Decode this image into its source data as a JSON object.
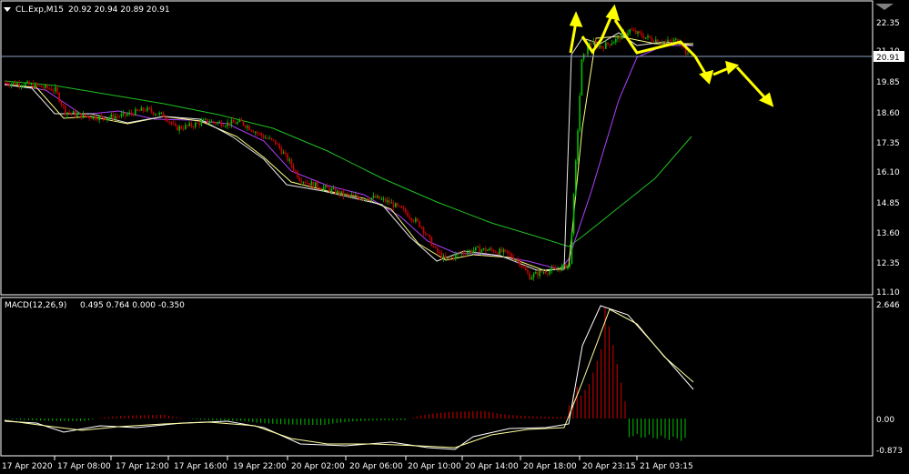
{
  "header": {
    "symbol": "CL.Exp,M15",
    "ohlc": "20.92 20.94 20.89 20.91"
  },
  "macd": {
    "label": "MACD(12,26,9)",
    "values": "0.495 0.764 0.000 -0.350"
  },
  "price_axis": {
    "ticks": [
      "22.35",
      "21.10",
      "19.85",
      "18.60",
      "17.35",
      "16.10",
      "14.85",
      "13.60",
      "12.35",
      "11.10"
    ],
    "current": "20.91"
  },
  "macd_axis": {
    "ticks": [
      "2.646",
      "0.00",
      "-0.873"
    ]
  },
  "time_axis": {
    "labels": [
      "17 Apr 2020",
      "17 Apr 08:00",
      "17 Apr 12:00",
      "17 Apr 16:00",
      "19 Apr 22:00",
      "20 Apr 02:00",
      "20 Apr 06:00",
      "20 Apr 10:00",
      "20 Apr 14:00",
      "20 Apr 18:00",
      "20 Apr 23:15",
      "21 Apr 03:15"
    ]
  },
  "colors": {
    "background": "#000000",
    "grid_border": "#ffffff",
    "bull": "#00c000",
    "bear": "#d00000",
    "ma_fast": "#ffffff",
    "ma_mid": "#ffff80",
    "ma_slow": "#b040ff",
    "ma_long": "#20c020",
    "arrows": "#ffff00",
    "current_line": "#8aa0c0",
    "macd_signal": "#ffffa0"
  },
  "chart_data": {
    "type": "candlestick",
    "symbol": "CL.Exp",
    "timeframe": "M15",
    "price_range": [
      11.1,
      22.6
    ],
    "current_price": 20.91,
    "close_path": [
      [
        0,
        19.8
      ],
      [
        10,
        19.75
      ],
      [
        20,
        19.6
      ],
      [
        25,
        19.5
      ],
      [
        30,
        18.6
      ],
      [
        40,
        18.4
      ],
      [
        50,
        18.35
      ],
      [
        60,
        18.45
      ],
      [
        70,
        18.7
      ],
      [
        80,
        18.4
      ],
      [
        85,
        17.9
      ],
      [
        92,
        18.0
      ],
      [
        100,
        18.2
      ],
      [
        110,
        18.1
      ],
      [
        118,
        18.15
      ],
      [
        128,
        17.6
      ],
      [
        135,
        17.3
      ],
      [
        142,
        16.5
      ],
      [
        147,
        15.8
      ],
      [
        152,
        15.6
      ],
      [
        160,
        15.4
      ],
      [
        170,
        15.1
      ],
      [
        178,
        15.0
      ],
      [
        185,
        15.0
      ],
      [
        192,
        14.8
      ],
      [
        200,
        14.4
      ],
      [
        208,
        13.8
      ],
      [
        215,
        12.8
      ],
      [
        220,
        12.4
      ],
      [
        228,
        12.7
      ],
      [
        236,
        12.85
      ],
      [
        244,
        12.8
      ],
      [
        250,
        12.7
      ],
      [
        256,
        12.4
      ],
      [
        262,
        11.7
      ],
      [
        268,
        11.9
      ],
      [
        275,
        12.0
      ],
      [
        282,
        12.2
      ],
      [
        288,
        20.7
      ],
      [
        292,
        21.5
      ],
      [
        298,
        21.3
      ],
      [
        305,
        21.6
      ],
      [
        312,
        22.0
      ],
      [
        320,
        21.7
      ],
      [
        330,
        21.5
      ],
      [
        337,
        21.6
      ],
      [
        341,
        20.91
      ]
    ],
    "macd_range": [
      -0.873,
      2.646
    ],
    "macd_path": [
      [
        0,
        0.0
      ],
      [
        40,
        -0.1
      ],
      [
        80,
        0.05
      ],
      [
        120,
        -0.05
      ],
      [
        160,
        -0.3
      ],
      [
        200,
        -0.35
      ],
      [
        240,
        -0.05
      ],
      [
        280,
        0.0
      ],
      [
        292,
        0.9
      ],
      [
        300,
        2.1
      ],
      [
        310,
        2.6
      ],
      [
        320,
        2.4
      ],
      [
        330,
        1.8
      ],
      [
        341,
        1.5
      ]
    ],
    "histogram_hint": "green/red bars around zero; large red spike near 20 Apr 23:15"
  }
}
